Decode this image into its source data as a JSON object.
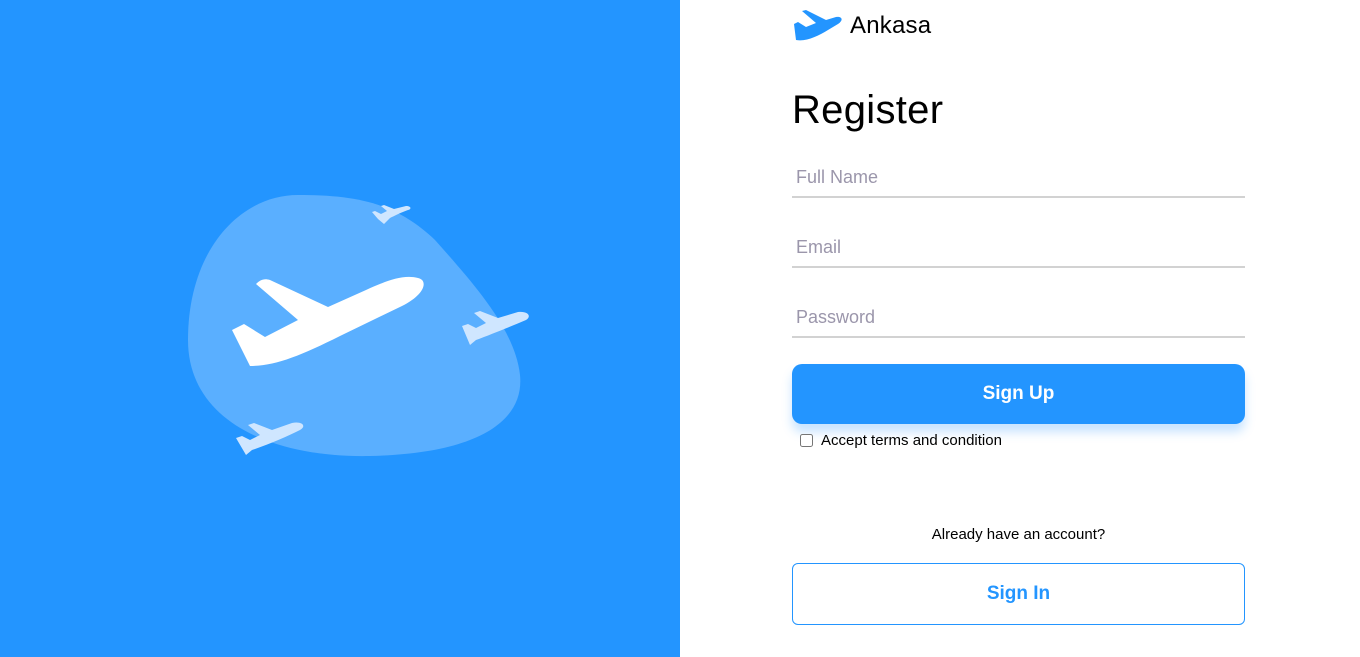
{
  "brand": {
    "name": "Ankasa",
    "icon": "plane-logo-icon"
  },
  "form": {
    "title": "Register",
    "full_name": {
      "placeholder": "Full Name",
      "value": ""
    },
    "email": {
      "placeholder": "Email",
      "value": ""
    },
    "password": {
      "placeholder": "Password",
      "value": ""
    },
    "signup_label": "Sign Up",
    "terms_label": "Accept terms and condition",
    "terms_checked": false,
    "already_text": "Already have an account?",
    "signin_label": "Sign In"
  },
  "illustration": {
    "icon": "airplane-blob-illustration"
  },
  "colors": {
    "accent": "#2395ff",
    "blob": "#5aafff",
    "field_underline": "#d2d2d2",
    "placeholder": "#9b96ab"
  }
}
